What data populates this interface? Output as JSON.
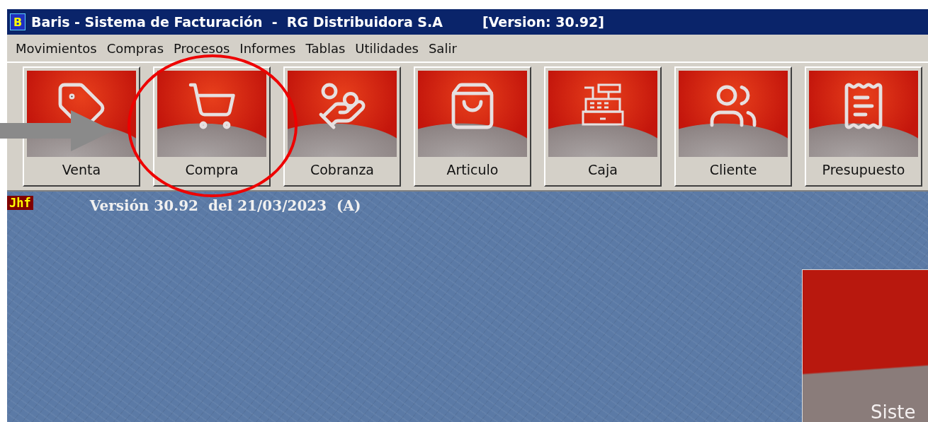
{
  "window": {
    "app_icon_letter": "B",
    "title": "Baris - Sistema de Facturación  -  RG Distribuidora S.A",
    "version_label": "[Version: 30.92]"
  },
  "menu": [
    "Movimientos",
    "Compras",
    "Procesos",
    "Informes",
    "Tablas",
    "Utilidades",
    "Salir"
  ],
  "toolbar": [
    {
      "label": "Venta",
      "kind": "tag"
    },
    {
      "label": "Compra",
      "kind": "cart"
    },
    {
      "label": "Cobranza",
      "kind": "coins"
    },
    {
      "label": "Articulo",
      "kind": "bag"
    },
    {
      "label": "Caja",
      "kind": "register"
    },
    {
      "label": "Cliente",
      "kind": "users"
    },
    {
      "label": "Presupuesto",
      "kind": "invoice"
    }
  ],
  "desktop": {
    "badge": "Jhf",
    "version_text": "Versión 30.92  del 21/03/2023  (A)",
    "splash_text": "Siste"
  }
}
